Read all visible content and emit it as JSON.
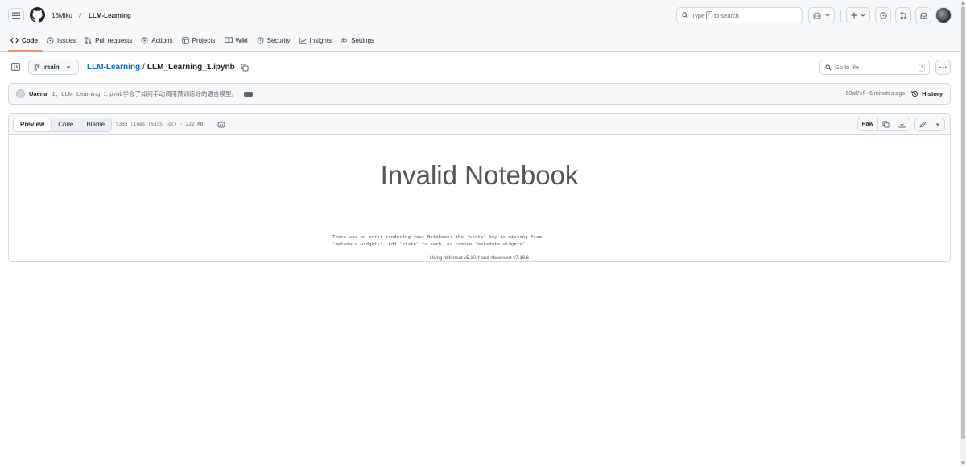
{
  "header": {
    "owner": "16Miku",
    "separator": "/",
    "repo": "LLM-Learning",
    "search_prefix": "Type",
    "search_key": "/",
    "search_suffix": "to search"
  },
  "nav": {
    "items": [
      {
        "label": "Code",
        "icon": "code-icon"
      },
      {
        "label": "Issues",
        "icon": "issue-icon"
      },
      {
        "label": "Pull requests",
        "icon": "pull-request-icon"
      },
      {
        "label": "Actions",
        "icon": "play-icon"
      },
      {
        "label": "Projects",
        "icon": "table-icon"
      },
      {
        "label": "Wiki",
        "icon": "book-icon"
      },
      {
        "label": "Security",
        "icon": "shield-icon"
      },
      {
        "label": "Insights",
        "icon": "graph-icon"
      },
      {
        "label": "Settings",
        "icon": "gear-icon"
      }
    ]
  },
  "file_header": {
    "branch": "main",
    "repo_link": "LLM-Learning",
    "path_sep": "/",
    "file_name": "LLM_Learning_1.ipynb",
    "goto_placeholder": "Go to file",
    "goto_key": "t"
  },
  "commit": {
    "author": "Uaena",
    "message": "1、LLM_Learning_1.ipynb学会了如何手动调用预训练好的语言模型。",
    "meta": "60af7ef · 6 minutes ago",
    "history_label": "History"
  },
  "file_toolbar": {
    "tabs": [
      "Preview",
      "Code",
      "Blame"
    ],
    "info": "5335 lines (5335 loc) · 222 KB",
    "raw_label": "Raw"
  },
  "notebook": {
    "title": "Invalid Notebook",
    "error_line1": "There was an error rendering your Notebook: the 'state' key is missing from",
    "error_line2": "'metadata.widgets'. Add 'state' to each, or remove 'metadata.widgets'.",
    "version": "Using nbformat v5.10.4 and nbconvert v7.16.6"
  },
  "colors": {
    "accent": "#0969da",
    "nav_underline": "#fd8c73",
    "border": "#d0d7de",
    "canvas_subtle": "#f6f8fa"
  }
}
